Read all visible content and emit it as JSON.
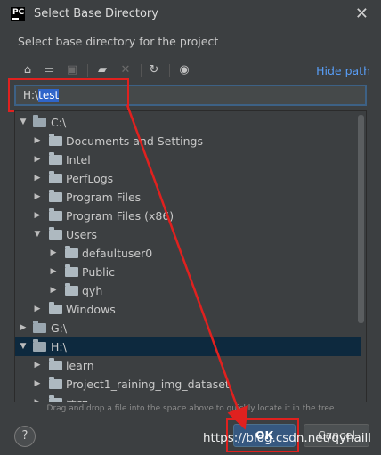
{
  "window": {
    "title": "Select Base Directory",
    "app_icon_text": "PC"
  },
  "description": "Select base directory for the project",
  "toolbar": {
    "icons": [
      "home-icon",
      "desktop-icon",
      "project-icon",
      "new-folder-icon",
      "delete-icon",
      "refresh-icon",
      "show-hidden-icon"
    ],
    "hide_path_label": "Hide path"
  },
  "path": {
    "prefix": "H:\\",
    "selected": "test"
  },
  "tree": {
    "rows": [
      {
        "label": "C:\\",
        "expanded": true,
        "drive": true
      },
      {
        "label": "Documents and Settings"
      },
      {
        "label": "Intel"
      },
      {
        "label": "PerfLogs"
      },
      {
        "label": "Program Files"
      },
      {
        "label": "Program Files (x86)"
      },
      {
        "label": "Users",
        "expanded": true
      },
      {
        "label": "defaultuser0"
      },
      {
        "label": "Public"
      },
      {
        "label": "qyh"
      },
      {
        "label": "Windows"
      },
      {
        "label": "G:\\",
        "drive": true
      },
      {
        "label": "H:\\",
        "expanded": true,
        "drive": true,
        "selected": true
      },
      {
        "label": "learn"
      },
      {
        "label": "Project1_raining_img_dataset"
      },
      {
        "label": "清明"
      }
    ]
  },
  "hint": "Drag and drop a file into the space above to quickly locate it in the tree",
  "buttons": {
    "help": "?",
    "ok": "OK",
    "cancel": "Cancel"
  },
  "watermark": "https://blog.csdn.net/qyhaill",
  "colors": {
    "background": "#3c3f41",
    "accent": "#589df6",
    "selection": "#0d293e",
    "annotation": "#e0211f"
  }
}
